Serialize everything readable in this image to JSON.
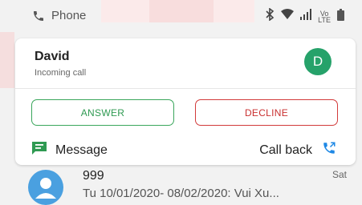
{
  "status_bar": {
    "app_name": "Phone",
    "volte_line1": "Vo",
    "volte_line2": "LTE"
  },
  "notification": {
    "caller_name": "David",
    "status": "Incoming call",
    "avatar_letter": "D",
    "answer_label": "ANSWER",
    "decline_label": "DECLINE",
    "message_label": "Message",
    "callback_label": "Call back"
  },
  "list_item": {
    "name": "999",
    "preview": "Tu 10/01/2020- 08/02/2020: Vui Xu...",
    "day": "Sat"
  },
  "colors": {
    "answer_green": "#2f9a52",
    "decline_red": "#c93030",
    "avatar_green": "#26a26a",
    "contact_blue": "#4aa0e0",
    "icon_blue": "#1e88e5"
  }
}
